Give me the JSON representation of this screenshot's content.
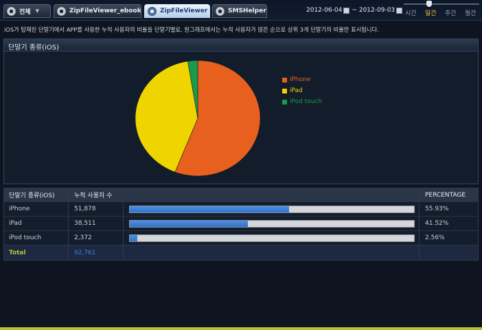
{
  "tabs": [
    {
      "label": "전체",
      "dropdown": true
    },
    {
      "label": "ZipFileViewer_ebook"
    },
    {
      "label": "ZipFileViewer",
      "active": true
    },
    {
      "label": "SMSHelper"
    }
  ],
  "date_range": {
    "start": "2012-06-04",
    "separator": "~",
    "end": "2012-09-03"
  },
  "period_options": [
    "시간",
    "일간",
    "주간",
    "월간"
  ],
  "selected_period": "일간",
  "description": "iOS가 탑재된 단말기에서 APP를 사용한 누적 사용자의 비율을 단말기별로, 원그래프에서는 누적 사용자가 많은 순으로 상위 3개 단말기의 비율만 표시됩니다.",
  "chart_panel": {
    "title": "단말기 종류(iOS)"
  },
  "chart_data": {
    "type": "pie",
    "categories": [
      "iPhone",
      "iPad",
      "iPod touch"
    ],
    "values": [
      55.93,
      41.52,
      2.56
    ],
    "colors": [
      "#e8601e",
      "#f0d400",
      "#1a9a4a"
    ],
    "legend": "right"
  },
  "table": {
    "headers": {
      "device": "단말기 종류(iOS)",
      "users": "누적 사용자 수",
      "percentage": "PERCENTAGE"
    },
    "rows": [
      {
        "device": "iPhone",
        "users": "51,878",
        "percentage": "55.93%",
        "fraction": 0.5593
      },
      {
        "device": "iPad",
        "users": "38,511",
        "percentage": "41.52%",
        "fraction": 0.4152
      },
      {
        "device": "iPod touch",
        "users": "2,372",
        "percentage": "2.56%",
        "fraction": 0.0256
      }
    ],
    "total": {
      "label": "Total",
      "value": "92,761"
    }
  },
  "colors": {
    "bar_fill": "#2f72cf",
    "accent": "#b8c23a",
    "active_period": "#f2cb38"
  }
}
